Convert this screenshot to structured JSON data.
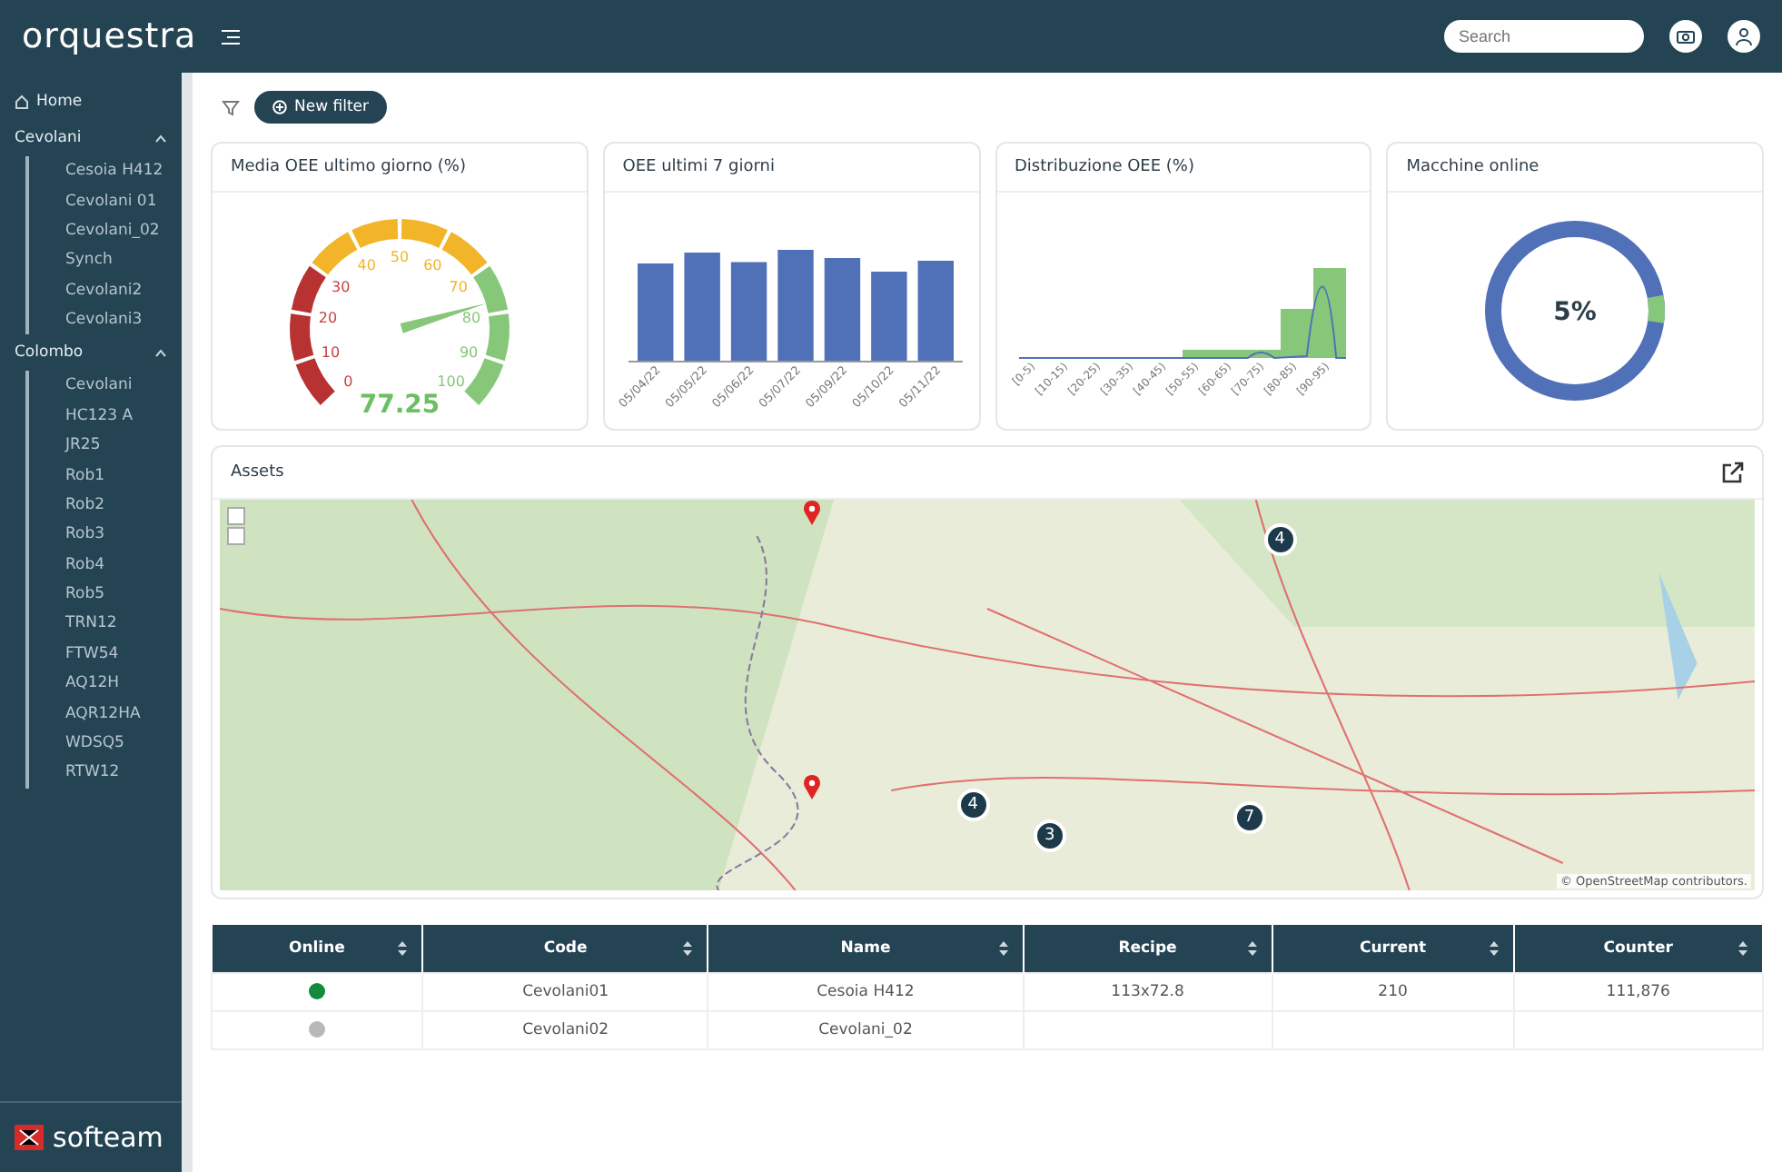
{
  "topbar": {
    "logo": "orquestra",
    "search": {
      "placeholder": "Search"
    }
  },
  "sidebar": {
    "home": "Home",
    "groups": [
      {
        "label": "Cevolani",
        "expanded": true,
        "children": [
          "Cesoia H412",
          "Cevolani 01",
          "Cevolani_02",
          "Synch",
          "Cevolani2",
          "Cevolani3"
        ]
      },
      {
        "label": "Colombo",
        "expanded": true,
        "children": [
          "Cevolani",
          "HC123 A",
          "JR25",
          "Rob1",
          "Rob2",
          "Rob3",
          "Rob4",
          "Rob5",
          "TRN12",
          "FTW54",
          "AQ12H",
          "AQR12HA",
          "WDSQ5",
          "RTW12"
        ]
      }
    ],
    "brand": "softeam"
  },
  "filter": {
    "button": "New filter"
  },
  "cards": [
    {
      "kind": "gauge",
      "title": "Media OEE ultimo giorno (%)",
      "value": "77.25",
      "ticks": [
        "0",
        "10",
        "20",
        "30",
        "40",
        "50",
        "60",
        "70",
        "80",
        "90",
        "100"
      ]
    },
    {
      "kind": "bars",
      "title": "OEE ultimi 7 giorni",
      "x_labels": [
        "05/04/22",
        "05/05/22",
        "05/06/22",
        "05/07/22",
        "05/09/22",
        "05/10/22",
        "05/11/22"
      ]
    },
    {
      "kind": "histogram",
      "title": "Distribuzione OEE (%)",
      "x_labels": [
        "[0-5)",
        "[10-15)",
        "[20-25)",
        "[30-35)",
        "[40-45)",
        "[50-55)",
        "[60-65)",
        "[70-75)",
        "[80-85)",
        "[90-95)"
      ]
    },
    {
      "kind": "donut",
      "title": "Macchine online",
      "value": "5%"
    }
  ],
  "assets": {
    "title": "Assets",
    "clusters": [
      "4",
      "4",
      "3",
      "7"
    ],
    "attribution": "© OpenStreetMap contributors."
  },
  "table": {
    "columns": [
      "Online",
      "Code",
      "Name",
      "Recipe",
      "Current",
      "Counter"
    ],
    "rows": [
      {
        "online": true,
        "code": "Cevolani01",
        "name": "Cesoia H412",
        "recipe": "113x72.8",
        "current": "210",
        "counter": "111,876"
      },
      {
        "online": false,
        "code": "Cevolani02",
        "name": "Cevolani_02"
      }
    ]
  }
}
